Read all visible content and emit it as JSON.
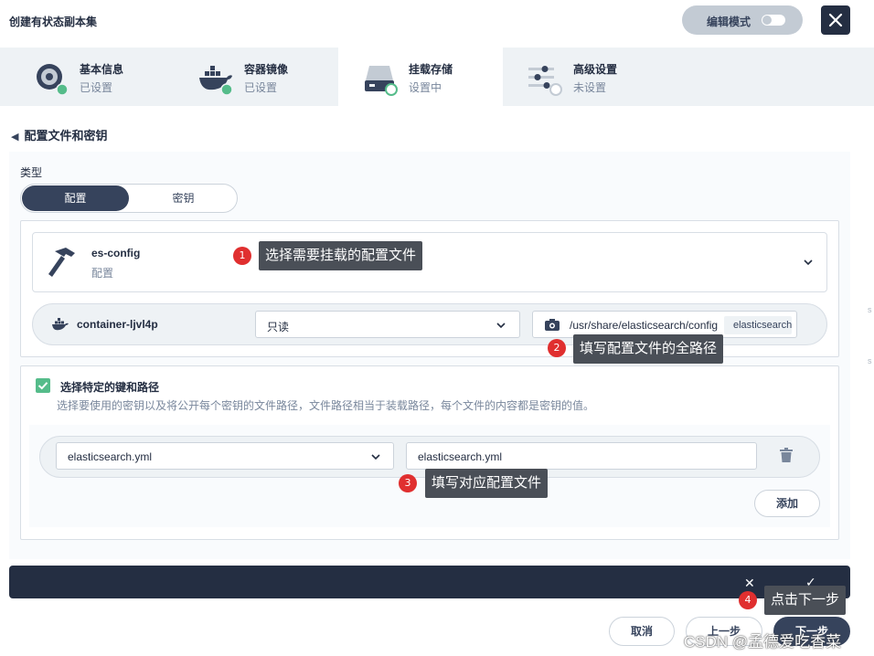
{
  "header": {
    "title": "创建有状态副本集",
    "edit_mode_label": "编辑模式",
    "close_icon": "close-icon"
  },
  "steps": [
    {
      "name": "基本信息",
      "status": "已设置",
      "icon": "disc-icon"
    },
    {
      "name": "容器镜像",
      "status": "已设置",
      "icon": "docker-icon"
    },
    {
      "name": "挂载存储",
      "status": "设置中",
      "icon": "storage-icon"
    },
    {
      "name": "高级设置",
      "status": "未设置",
      "icon": "sliders-icon"
    }
  ],
  "section": {
    "back_title": "配置文件和密钥"
  },
  "type_selector": {
    "label": "类型",
    "options": [
      "配置",
      "密钥"
    ],
    "selected": "配置"
  },
  "config_select": {
    "name": "es-config",
    "type": "配置"
  },
  "mount": {
    "container": "container-ljvl4p",
    "mode": "只读",
    "path": "/usr/share/elasticsearch/config",
    "path_tag": "elasticsearch.yml"
  },
  "keys_section": {
    "checkbox_label": "选择特定的键和路径",
    "checked": true,
    "description": "选择要使用的密钥以及将公开每个密钥的文件路径，文件路径相当于装载路径，每个文件的内容都是密钥的值。",
    "key": "elasticsearch.yml",
    "path": "elasticsearch.yml",
    "add_label": "添加"
  },
  "footer": {
    "cancel_label": "取消",
    "prev_label": "上一步",
    "next_label": "下一步"
  },
  "annotations": [
    {
      "num": "1",
      "text": "选择需要挂载的配置文件"
    },
    {
      "num": "2",
      "text": "填写配置文件的全路径"
    },
    {
      "num": "3",
      "text": "填写对应配置文件"
    },
    {
      "num": "4",
      "text": "点击下一步"
    }
  ],
  "watermark": "CSDN @孟德爱吃香菜",
  "colors": {
    "dark": "#242e42",
    "primary": "#36435c",
    "success": "#55bc8a",
    "annotation_red": "#e02f2f"
  }
}
